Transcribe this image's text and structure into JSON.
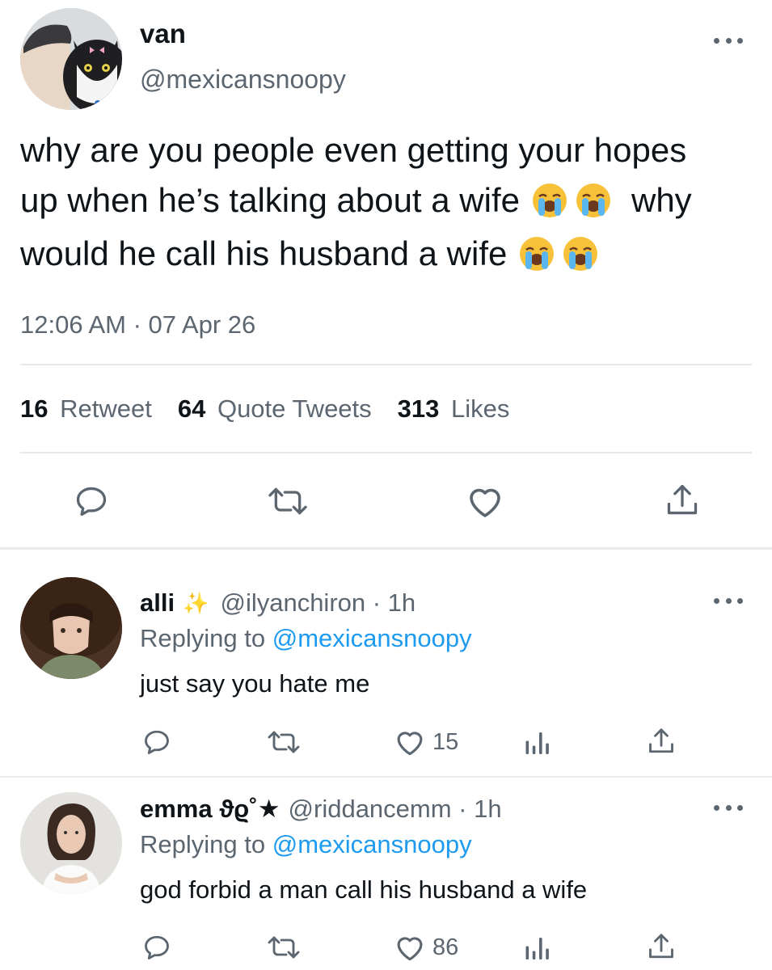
{
  "main_tweet": {
    "display_name": "van",
    "handle": "@mexicansnoopy",
    "text_line1": "why are you people even getting your hopes",
    "text_line2_a": "up when he’s talking about a wife",
    "text_line2_b": "why",
    "text_line3": "would he call his husband a wife",
    "timestamp": "12:06 AM · 07 Apr 26",
    "stats": {
      "retweets_count": "16",
      "retweets_label": "Retweet",
      "quotes_count": "64",
      "quotes_label": "Quote Tweets",
      "likes_count": "313",
      "likes_label": "Likes"
    }
  },
  "replies": [
    {
      "display_name": "alli",
      "name_decoration": "✨",
      "handle_time": "@ilyanchiron · 1h",
      "replying_prefix": "Replying to",
      "replying_handle": "@mexicansnoopy",
      "text": "just say you hate me",
      "like_count": "15"
    },
    {
      "display_name": "emma ϑϱ˚★",
      "handle_time": "@riddancemm · 1h",
      "replying_prefix": "Replying to",
      "replying_handle": "@mexicansnoopy",
      "text": "god forbid a man call his husband a wife",
      "like_count": "86"
    }
  ],
  "colors": {
    "text": "#0f1419",
    "secondary": "#5b6670",
    "link": "#1d9bf0",
    "divider": "#e6e9ec"
  },
  "icons": [
    "more-icon",
    "reply-icon",
    "retweet-icon",
    "like-icon",
    "share-icon",
    "analytics-icon",
    "loudly-crying-face-emoji"
  ]
}
